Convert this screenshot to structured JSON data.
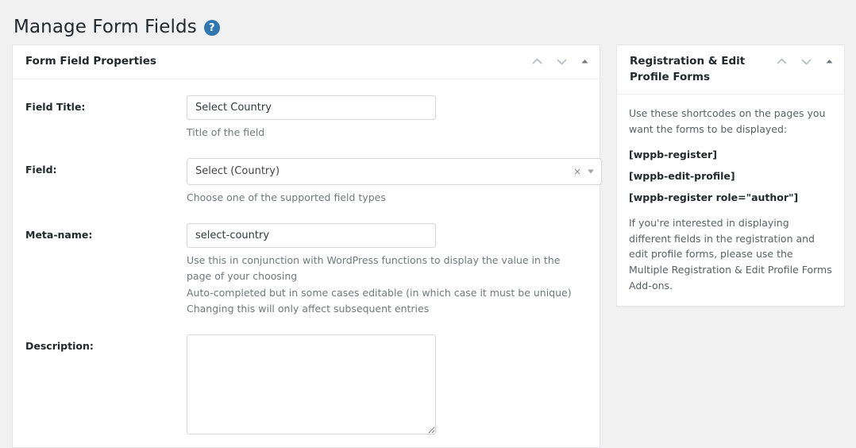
{
  "page": {
    "title": "Manage Form Fields",
    "help_icon": "question-mark-circle-icon",
    "help_glyph": "?"
  },
  "colors": {
    "page_background": "#f1f1f1",
    "panel_background": "#ffffff",
    "panel_border": "#e2e4e7",
    "help_icon_blue": "#2e77b0",
    "label_text": "#23282d",
    "hint_text": "#72777c",
    "input_border": "#d5d5d5"
  },
  "panel_actions": {
    "move_up": "chevron-up-icon",
    "move_down": "chevron-down-icon",
    "toggle": "triangle-up-icon"
  },
  "main_panel": {
    "title": "Form Field Properties",
    "rows": [
      {
        "label": "Field Title:",
        "type": "text",
        "value": "Select Country",
        "placeholder": "",
        "hints": [
          "Title of the field"
        ]
      },
      {
        "label": "Field:",
        "type": "select",
        "value": "Select (Country)",
        "clear_glyph": "×",
        "hints": [
          "Choose one of the supported field types"
        ]
      },
      {
        "label": "Meta-name:",
        "type": "text",
        "value": "select-country",
        "placeholder": "",
        "hints": [
          "Use this in conjunction with WordPress functions to display the value in the page of your choosing",
          "Auto-completed but in some cases editable (in which case it must be unique)",
          "Changing this will only affect subsequent entries"
        ]
      },
      {
        "label": "Description:",
        "type": "textarea",
        "value": "",
        "placeholder": "",
        "hints": []
      }
    ]
  },
  "sidebar": {
    "title": "Registration & Edit Profile Forms",
    "intro": "Use these shortcodes on the pages you want the forms to be displayed:",
    "shortcodes": [
      "[wppb-register]",
      "[wppb-edit-profile]",
      "[wppb-register role=\"author\"]"
    ],
    "outro": "If you're interested in displaying different fields in the registration and edit profile forms, please use the Multiple Registration & Edit Profile Forms Add-ons."
  }
}
